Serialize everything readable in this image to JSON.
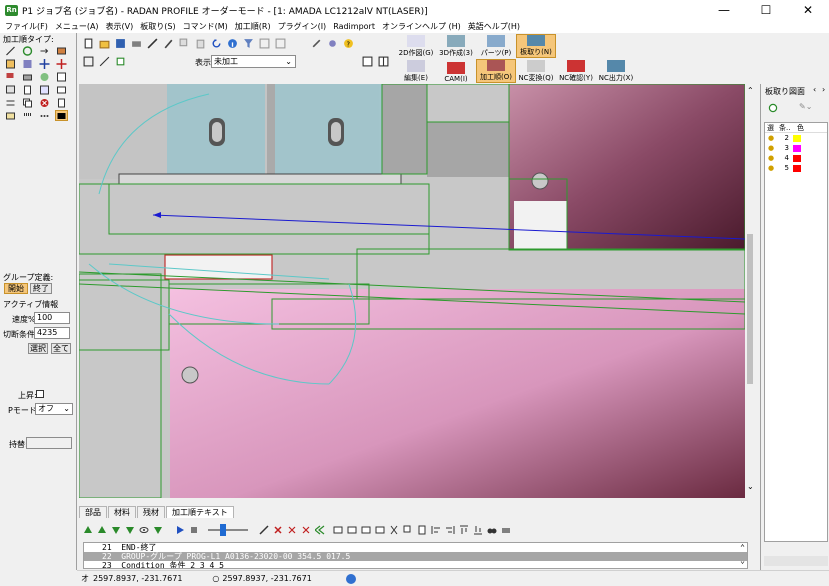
{
  "window": {
    "title": "P1 ジョブ名 (ジョブ名) - RADAN PROFILE オーダーモード - [1: AMADA LC1212alV NT(LASER)]",
    "app_icon": "Rn",
    "minimize": "—",
    "maximize": "☐",
    "close": "✕"
  },
  "menu": [
    "ファイル(F)",
    "メニュー(A)",
    "表示(V)",
    "板取り(S)",
    "コマンド(M)",
    "加工順(R)",
    "プラグイン(I)",
    "Radimport",
    "オンラインヘルプ (H)",
    "英語ヘルプ(H)"
  ],
  "left_panel": {
    "title": "加工順タイプ:",
    "group_title": "グループ定義:",
    "group_start": "開始",
    "group_end": "終了",
    "active_title": "アクティブ情報",
    "speed_label": "速度%",
    "speed_value": "100",
    "cut_cond_label": "切断条件",
    "cut_cond_value": "4235",
    "select_btn": "選択",
    "all_btn": "全て",
    "rise_label": "上昇:",
    "pmode_label": "Pモード:",
    "pmode_value": "オフ",
    "hold_label": "持替:"
  },
  "toolbar": {
    "display_label": "表示:",
    "display_value": "未加工",
    "big_buttons_top": [
      "2D作図(G)",
      "3D作成(3)",
      "パーツ(P)",
      "板取り(N)"
    ],
    "big_buttons_bottom": [
      "編集(E)",
      "CAM(I)",
      "加工順(O)",
      "NC変換(Q)",
      "NC確認(Y)",
      "NC出力(X)"
    ]
  },
  "right_panel": {
    "title": "板取り図面",
    "col_sel": "選",
    "col_cond": "条..",
    "col_color": "色",
    "rows": [
      {
        "cond": "2",
        "color": "#ffff00"
      },
      {
        "cond": "3",
        "color": "#ff00ff"
      },
      {
        "cond": "4",
        "color": "#ff0000"
      },
      {
        "cond": "5",
        "color": "#ff0000"
      }
    ]
  },
  "bottom": {
    "tabs": [
      "部品",
      "材料",
      "残材",
      "加工順テキスト"
    ],
    "lines": [
      {
        "num": "21",
        "text": "END-終了"
      },
      {
        "num": "22",
        "text": "GROUP-グループ PROG-L1 A0136-23020-00 354.5 017.5"
      },
      {
        "num": "23",
        "text": "Condition 条件 2 3 4 5"
      }
    ]
  },
  "status": {
    "coord1_prefix": "オ",
    "coord1": "2597.8937, -231.7671",
    "coord2": "2597.8937, -231.7671"
  },
  "colors": {
    "accent_active": "#f5c67a",
    "canvas_bg": "#c8c8c8",
    "green_line": "#2e9a2e",
    "cyan_line": "#5cc8c8",
    "blue_arrow": "#1a1ad0",
    "pink_part": "#f0b4dc",
    "maroon_part": "#6a2a40"
  }
}
